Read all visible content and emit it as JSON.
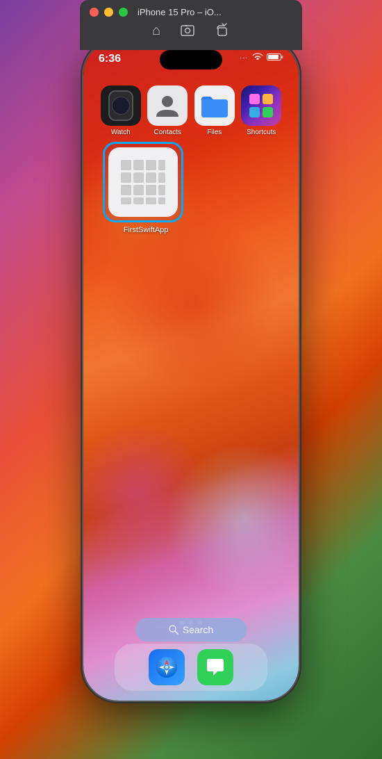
{
  "titleBar": {
    "title": "iPhone 15 Pro – iO...",
    "controls": {
      "home": "⌂",
      "screenshot": "📷",
      "rotate": "⤾"
    }
  },
  "statusBar": {
    "time": "6:36",
    "icons": [
      "...",
      "WiFi",
      "Battery"
    ]
  },
  "appRow1": [
    {
      "name": "watch-app",
      "label": "Watch",
      "type": "watch"
    },
    {
      "name": "contacts-app",
      "label": "Contacts",
      "type": "contacts"
    },
    {
      "name": "files-app",
      "label": "Files",
      "type": "files"
    },
    {
      "name": "shortcuts-app",
      "label": "Shortcuts",
      "type": "shortcuts"
    }
  ],
  "selectedApp": {
    "name": "FirstSwiftApp",
    "label": "FirstSwiftApp"
  },
  "searchBar": {
    "icon": "🔍",
    "placeholder": "Search"
  },
  "dock": [
    {
      "name": "safari-app",
      "label": "Safari",
      "type": "safari"
    },
    {
      "name": "messages-app",
      "label": "Messages",
      "type": "messages"
    }
  ]
}
